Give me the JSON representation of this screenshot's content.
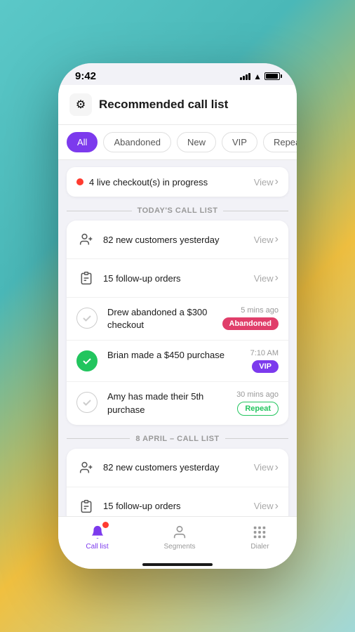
{
  "status_bar": {
    "time": "9:42"
  },
  "header": {
    "title": "Recommended call list",
    "gear_label": "⚙"
  },
  "filters": {
    "tabs": [
      {
        "id": "all",
        "label": "All",
        "active": true
      },
      {
        "id": "abandoned",
        "label": "Abandoned",
        "active": false
      },
      {
        "id": "new",
        "label": "New",
        "active": false
      },
      {
        "id": "vip",
        "label": "VIP",
        "active": false
      },
      {
        "id": "repeat",
        "label": "Repeat",
        "active": false
      }
    ]
  },
  "live_banner": {
    "text": "4 live checkout(s) in progress",
    "view_label": "View"
  },
  "today_section": {
    "label": "TODAY'S CALL LIST",
    "rows": [
      {
        "icon": "person-add",
        "text": "82 new customers yesterday",
        "view": "View"
      },
      {
        "icon": "clipboard",
        "text": "15 follow-up orders",
        "view": "View"
      }
    ],
    "items": [
      {
        "checked": false,
        "title": "Drew abandoned a $300 checkout",
        "time": "5 mins ago",
        "badge": "Abandoned",
        "badge_type": "abandoned"
      },
      {
        "checked": true,
        "title": "Brian made a $450 purchase",
        "time": "7:10 AM",
        "badge": "VIP",
        "badge_type": "vip"
      },
      {
        "checked": false,
        "title": "Amy has made their 5th purchase",
        "time": "30 mins ago",
        "badge": "Repeat",
        "badge_type": "repeat"
      }
    ]
  },
  "april_section": {
    "label": "8 APRIL – CALL LIST",
    "rows": [
      {
        "icon": "person-add",
        "text": "82 new customers yesterday",
        "view": "View"
      },
      {
        "icon": "clipboard",
        "text": "15 follow-up orders",
        "view": "View"
      }
    ]
  },
  "bottom_nav": {
    "items": [
      {
        "id": "call-list",
        "label": "Call list",
        "icon": "bell",
        "active": true,
        "badge": true
      },
      {
        "id": "segments",
        "label": "Segments",
        "icon": "person",
        "active": false,
        "badge": false
      },
      {
        "id": "dialer",
        "label": "Dialer",
        "icon": "grid",
        "active": false,
        "badge": false
      }
    ]
  }
}
